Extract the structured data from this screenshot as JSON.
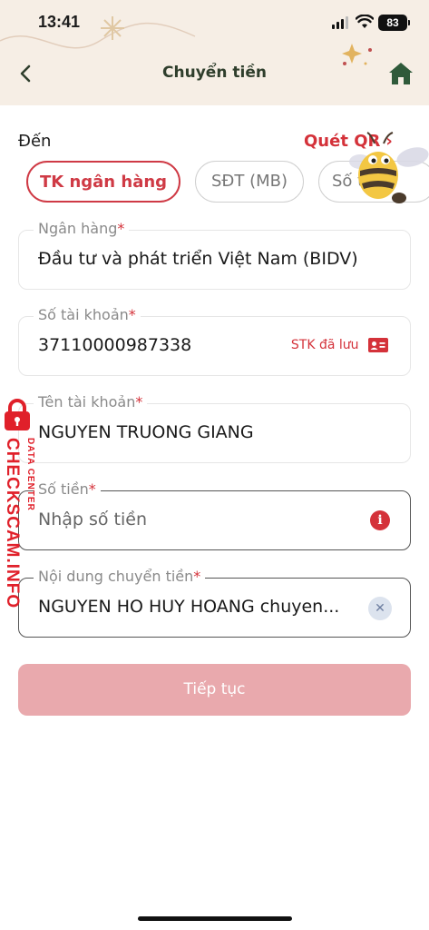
{
  "status_bar": {
    "time": "13:41",
    "battery": "83"
  },
  "header": {
    "title": "Chuyển tiền",
    "back_icon": "chevron-left-icon",
    "home_icon": "home-icon"
  },
  "recipient": {
    "label": "Đến",
    "scan_qr_label": "Quét QR",
    "tabs": [
      {
        "label": "TK ngân hàng",
        "selected": true
      },
      {
        "label": "SĐT (MB)",
        "selected": false
      },
      {
        "label": "Số thẻ",
        "selected": false
      }
    ]
  },
  "fields": {
    "bank": {
      "label": "Ngân hàng",
      "required_mark": "*",
      "value": "Đầu tư và phát triển Việt Nam (BIDV)"
    },
    "account_number": {
      "label": "Số tài khoản",
      "required_mark": "*",
      "value": "37110000987338",
      "saved_link": "STK đã lưu"
    },
    "account_name": {
      "label": "Tên tài khoản",
      "required_mark": "*",
      "value": "NGUYEN TRUONG GIANG"
    },
    "amount": {
      "label": "Số tiền",
      "required_mark": "*",
      "placeholder": "Nhập số tiền"
    },
    "content": {
      "label": "Nội dung chuyển tiền",
      "required_mark": "*",
      "value": "NGUYEN HO HUY HOANG chuyen..."
    }
  },
  "continue_button": {
    "label": "Tiếp tục"
  },
  "watermark": {
    "main": "CHECKSCAM.INFO",
    "sub": "DATA CENTER"
  },
  "colors": {
    "accent": "#d4323a",
    "header_bg": "#f6eee5",
    "button_disabled": "#e9a9ad"
  }
}
